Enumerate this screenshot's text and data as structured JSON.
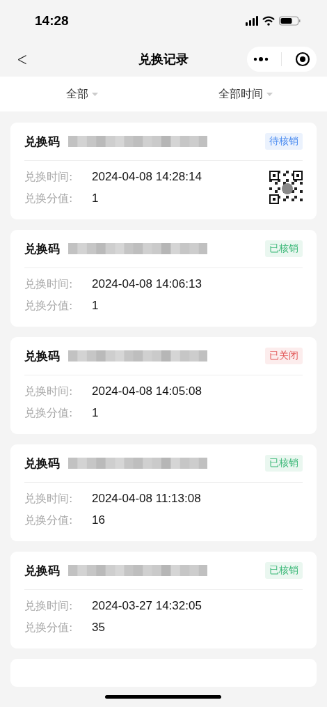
{
  "status_bar": {
    "time": "14:28"
  },
  "nav": {
    "title": "兑换记录",
    "back": "<"
  },
  "filters": [
    {
      "label": "全部"
    },
    {
      "label": "全部时间"
    }
  ],
  "records": [
    {
      "code_label": "兑换码",
      "status": "待核销",
      "color": "#4a8bf0",
      "time_label": "兑换时间:",
      "time": "2024-04-08 14:28:14",
      "value_label": "兑换分值:",
      "value": "1",
      "has_qr": true
    },
    {
      "code_label": "兑换码",
      "status": "已核销",
      "color": "#3cb878",
      "time_label": "兑换时间:",
      "time": "2024-04-08 14:06:13",
      "value_label": "兑换分值:",
      "value": "1",
      "has_qr": false
    },
    {
      "code_label": "兑换码",
      "status": "已关闭",
      "color": "#e25a5a",
      "time_label": "兑换时间:",
      "time": "2024-04-08 14:05:08",
      "value_label": "兑换分值:",
      "value": "1",
      "has_qr": false
    },
    {
      "code_label": "兑换码",
      "status": "已核销",
      "color": "#3cb878",
      "time_label": "兑换时间:",
      "time": "2024-04-08 11:13:08",
      "value_label": "兑换分值:",
      "value": "16",
      "has_qr": false
    },
    {
      "code_label": "兑换码",
      "status": "已核销",
      "color": "#3cb878",
      "time_label": "兑换时间:",
      "time": "2024-03-27 14:32:05",
      "value_label": "兑换分值:",
      "value": "35",
      "has_qr": false
    }
  ]
}
